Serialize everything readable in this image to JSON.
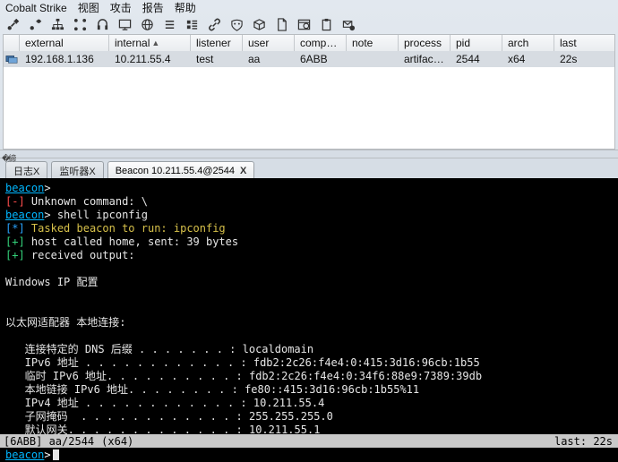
{
  "menubar": {
    "app": "Cobalt Strike",
    "items": [
      "视图",
      "攻击",
      "报告",
      "帮助"
    ]
  },
  "toolbar_icons": [
    "plus-icon",
    "link-icon",
    "formation-icon",
    "disconnect-icon",
    "screen-icon",
    "target-icon",
    "crosshair-icon",
    "list-icon",
    "qr-icon",
    "chainlink-icon",
    "mask-icon",
    "package-icon",
    "document-icon",
    "world-icon",
    "clipboard-icon",
    "headset-icon"
  ],
  "table": {
    "headers": {
      "external": "external",
      "internal": "internal",
      "listener": "listener",
      "user": "user",
      "computer": "comput…",
      "note": "note",
      "process": "process",
      "pid": "pid",
      "arch": "arch",
      "last": "last"
    },
    "row": {
      "external": "192.168.1.136",
      "internal": "10.211.55.4",
      "listener": "test",
      "user": "aa",
      "computer": "6ABB",
      "note": "",
      "process": "artifact…",
      "pid": "2544",
      "arch": "x64",
      "last": "22s"
    }
  },
  "tabs": {
    "inactive1": "日志X",
    "inactive2": "监听器X",
    "active": "Beacon 10.211.55.4@2544",
    "close": "X"
  },
  "terminal": {
    "l1_prompt": "beacon",
    "l1_arrow": ">",
    "l2_tag": "[-]",
    "l2_text": "Unknown command: \\",
    "l3_prompt": "beacon",
    "l3_arrow": ">",
    "l3_cmd": "shell ipconfig",
    "l4_tag": "[*]",
    "l4_text": "Tasked beacon to run: ipconfig",
    "l5_tag": "[+]",
    "l5_text": "host called home, sent: 39 bytes",
    "l6_tag": "[+]",
    "l6_text": "received output:",
    "l7": "",
    "l8": "Windows IP 配置",
    "l9": "",
    "l10": "",
    "l11": "以太网适配器 本地连接:",
    "l12": "",
    "l13": "   连接特定的 DNS 后缀 . . . . . . . : localdomain",
    "l14": "   IPv6 地址 . . . . . . . . . . . . : fdb2:2c26:f4e4:0:415:3d16:96cb:1b55",
    "l15": "   临时 IPv6 地址. . . . . . . . . . : fdb2:2c26:f4e4:0:34f6:88e9:7389:39db",
    "l16": "   本地链接 IPv6 地址. . . . . . . . : fe80::415:3d16:96cb:1b55%11",
    "l17": "   IPv4 地址 . . . . . . . . . . . . : 10.211.55.4",
    "l18": "   子网掩码  . . . . . . . . . . . . : 255.255.255.0",
    "l19": "   默认网关. . . . . . . . . . . . . : 10.211.55.1",
    "l20": ""
  },
  "statusbar": {
    "left": "[6ABB] aa/2544",
    "mid": "(x64)",
    "right": "last: 22s"
  },
  "prompt": {
    "p": "beacon",
    "arrow": ">"
  }
}
